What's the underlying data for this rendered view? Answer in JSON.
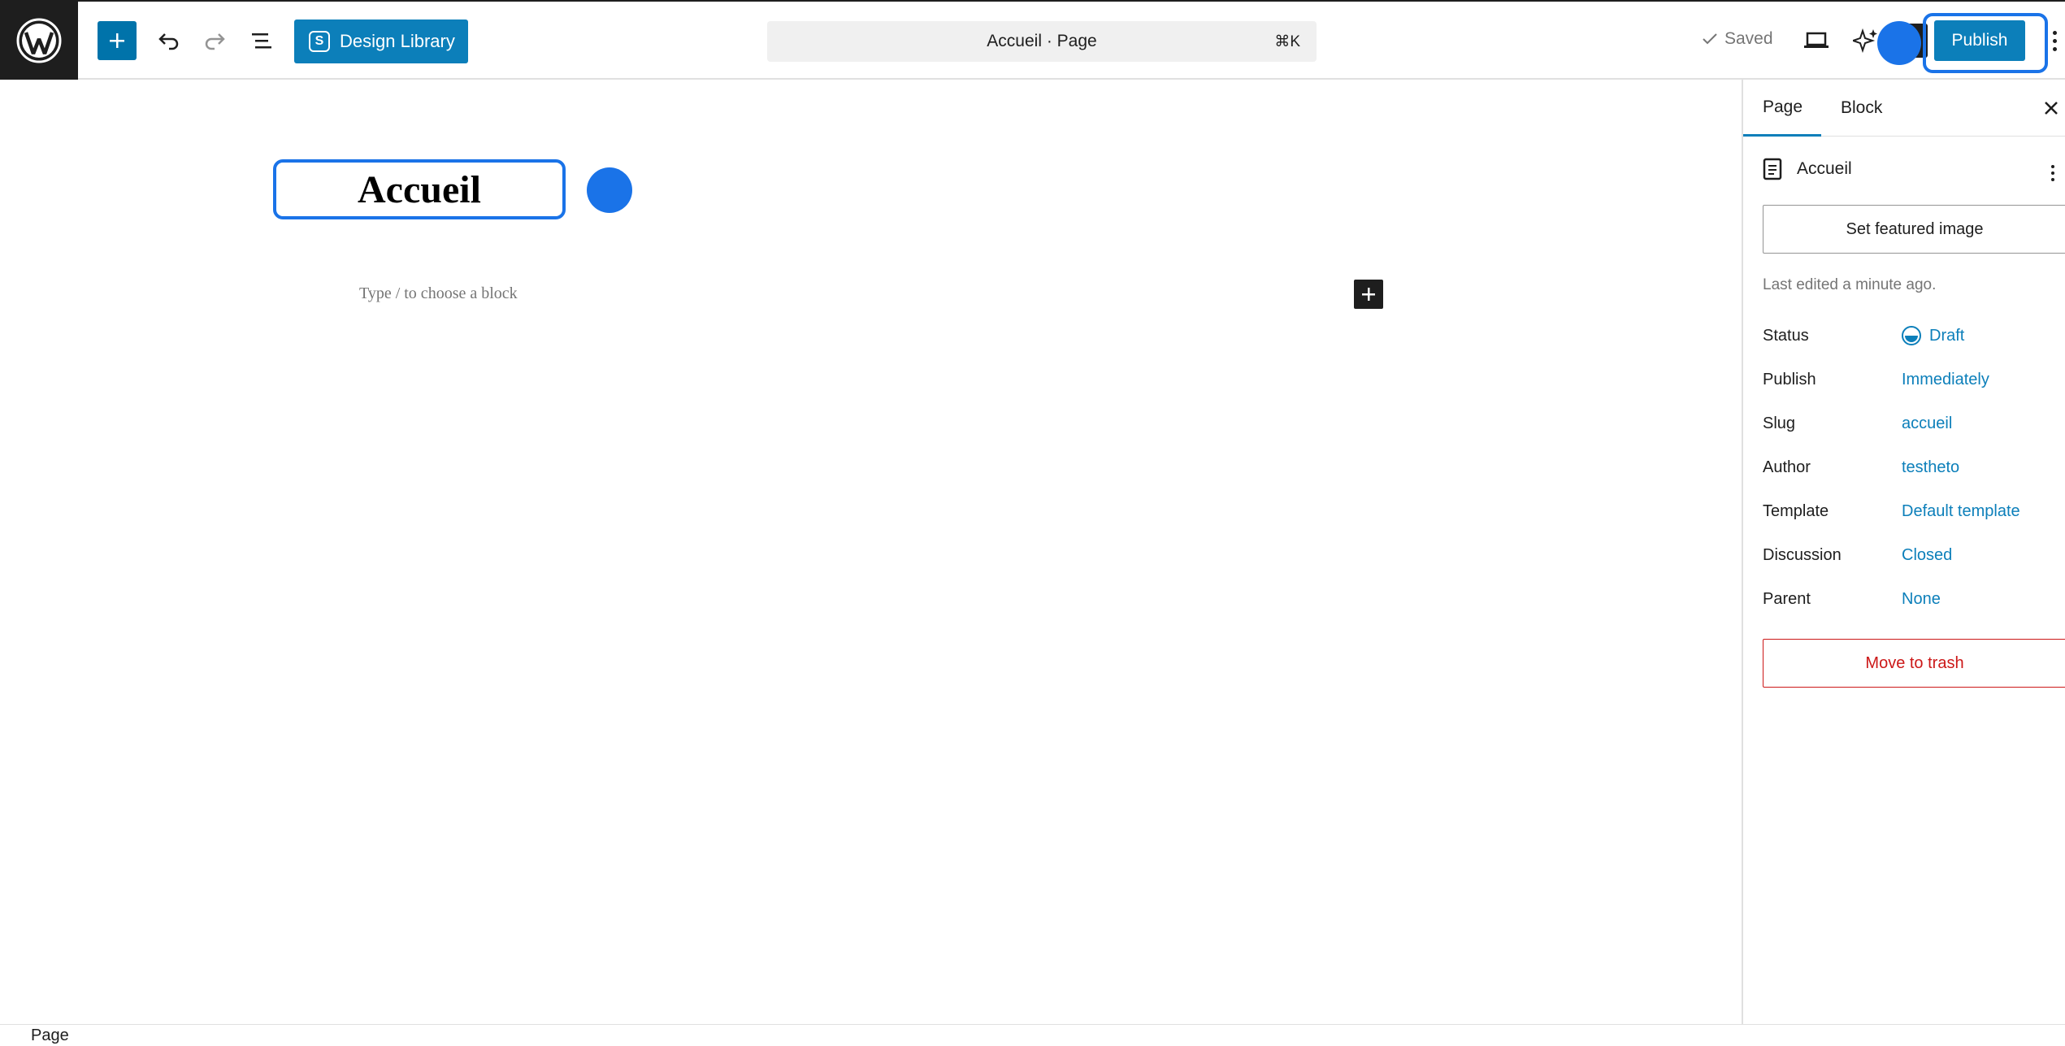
{
  "toolbar": {
    "design_library_label": "Design Library",
    "command_bar_text": "Accueil · Page",
    "command_shortcut": "⌘K",
    "saved_label": "Saved",
    "publish_label": "Publish"
  },
  "editor": {
    "title": "Accueil",
    "placeholder": "Type / to choose a block"
  },
  "sidebar": {
    "tabs": [
      {
        "label": "Page",
        "active": true
      },
      {
        "label": "Block",
        "active": false
      }
    ],
    "document_title": "Accueil",
    "featured_image_label": "Set featured image",
    "last_edited": "Last edited a minute ago.",
    "meta": {
      "status": {
        "label": "Status",
        "value": "Draft"
      },
      "publish": {
        "label": "Publish",
        "value": "Immediately"
      },
      "slug": {
        "label": "Slug",
        "value": "accueil"
      },
      "author": {
        "label": "Author",
        "value": "testheto"
      },
      "template": {
        "label": "Template",
        "value": "Default template"
      },
      "discussion": {
        "label": "Discussion",
        "value": "Closed"
      },
      "parent": {
        "label": "Parent",
        "value": "None"
      }
    },
    "trash_label": "Move to trash"
  },
  "footer": {
    "breadcrumb": "Page"
  },
  "colors": {
    "accent": "#0c7fba",
    "highlight": "#1a73e8",
    "danger": "#cc1818"
  }
}
